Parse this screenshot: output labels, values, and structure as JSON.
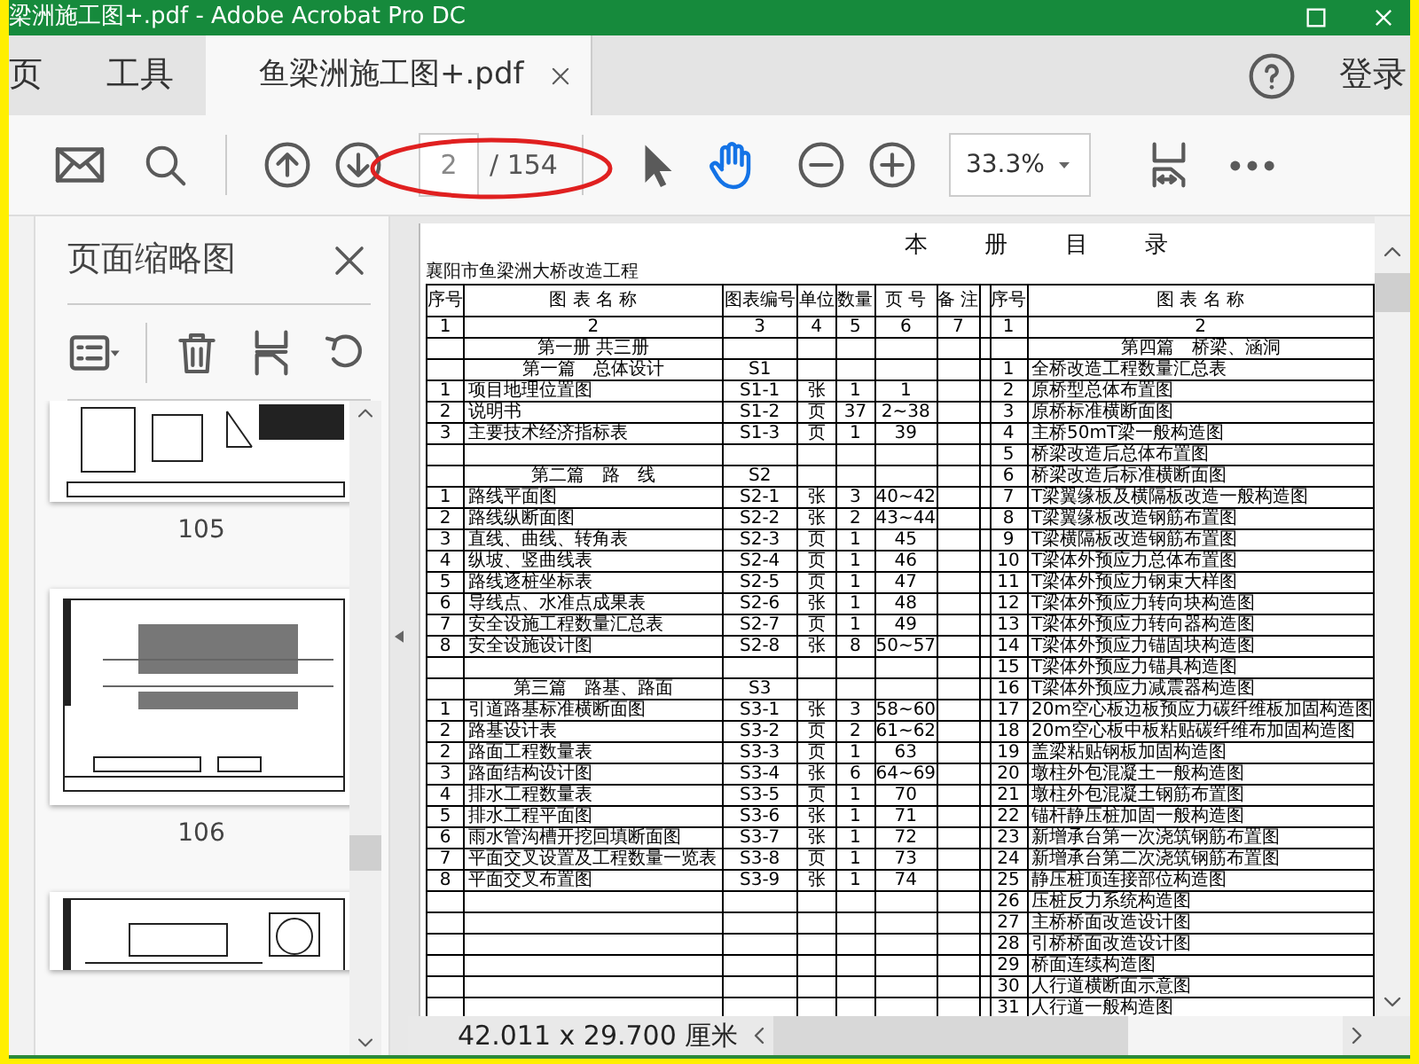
{
  "window": {
    "title": "梁洲施工图+.pdf - Adobe Acrobat Pro DC"
  },
  "tabs": [
    {
      "label": "页",
      "selected": false,
      "closable": false
    },
    {
      "label": "工具",
      "selected": false,
      "closable": false
    },
    {
      "label": "鱼梁洲施工图+.pdf",
      "selected": true,
      "closable": true
    }
  ],
  "account": {
    "sign_in": "登录"
  },
  "toolbar": {
    "page_number": "2",
    "page_count": "/ 154",
    "zoom": "33.3%",
    "tools": [
      {
        "kind": "select",
        "selected": false
      },
      {
        "kind": "hand",
        "selected": true
      }
    ]
  },
  "sidebar": {
    "title": "页面缩略图",
    "thumbnails": [
      {
        "kind": "detail",
        "label": "105"
      },
      {
        "kind": "section",
        "label": "106"
      },
      {
        "kind": "elevation"
      }
    ]
  },
  "document": {
    "title": "本 册 目 录",
    "project": "襄阳市鱼梁洲大桥改造工程",
    "left_table": {
      "columns": [
        "序号",
        "图 表 名 称",
        "图表编号",
        "单位",
        "数量",
        "页 号",
        "备 注"
      ],
      "rows": [
        {
          "kind": "index",
          "cells": [
            "1",
            "2",
            "3",
            "4",
            "5",
            "6",
            "7"
          ]
        },
        {
          "kind": "section",
          "title": "第一册 共三册"
        },
        {
          "kind": "section",
          "title": "第一篇　总体设计",
          "code": "S1"
        },
        {
          "kind": "item",
          "no": "1",
          "name": "项目地理位置图",
          "code": "S1-1",
          "unit": "张",
          "count": "1",
          "pages": "1"
        },
        {
          "kind": "item",
          "no": "2",
          "name": "说明书",
          "code": "S1-2",
          "unit": "页",
          "count": "37",
          "pages": "2~38"
        },
        {
          "kind": "item",
          "no": "3",
          "name": "主要技术经济指标表",
          "code": "S1-3",
          "unit": "页",
          "count": "1",
          "pages": "39"
        },
        {
          "kind": "blank"
        },
        {
          "kind": "section",
          "title": "第二篇　路　线",
          "code": "S2"
        },
        {
          "kind": "item",
          "no": "1",
          "name": "路线平面图",
          "code": "S2-1",
          "unit": "张",
          "count": "3",
          "pages": "40~42"
        },
        {
          "kind": "item",
          "no": "2",
          "name": "路线纵断面图",
          "code": "S2-2",
          "unit": "张",
          "count": "2",
          "pages": "43~44"
        },
        {
          "kind": "item",
          "no": "3",
          "name": "直线、曲线、转角表",
          "code": "S2-3",
          "unit": "页",
          "count": "1",
          "pages": "45"
        },
        {
          "kind": "item",
          "no": "4",
          "name": "纵坡、竖曲线表",
          "code": "S2-4",
          "unit": "页",
          "count": "1",
          "pages": "46"
        },
        {
          "kind": "item",
          "no": "5",
          "name": "路线逐桩坐标表",
          "code": "S2-5",
          "unit": "页",
          "count": "1",
          "pages": "47"
        },
        {
          "kind": "item",
          "no": "6",
          "name": "导线点、水准点成果表",
          "code": "S2-6",
          "unit": "张",
          "count": "1",
          "pages": "48"
        },
        {
          "kind": "item",
          "no": "7",
          "name": "安全设施工程数量汇总表",
          "code": "S2-7",
          "unit": "页",
          "count": "1",
          "pages": "49"
        },
        {
          "kind": "item",
          "no": "8",
          "name": "安全设施设计图",
          "code": "S2-8",
          "unit": "张",
          "count": "8",
          "pages": "50~57"
        },
        {
          "kind": "blank"
        },
        {
          "kind": "section",
          "title": "第三篇　路基、路面",
          "code": "S3"
        },
        {
          "kind": "item",
          "no": "1",
          "name": "引道路基标准横断面图",
          "code": "S3-1",
          "unit": "张",
          "count": "3",
          "pages": "58~60"
        },
        {
          "kind": "item",
          "no": "2",
          "name": "路基设计表",
          "code": "S3-2",
          "unit": "页",
          "count": "2",
          "pages": "61~62"
        },
        {
          "kind": "item",
          "no": "2",
          "name": "路面工程数量表",
          "code": "S3-3",
          "unit": "页",
          "count": "1",
          "pages": "63"
        },
        {
          "kind": "item",
          "no": "3",
          "name": "路面结构设计图",
          "code": "S3-4",
          "unit": "张",
          "count": "6",
          "pages": "64~69"
        },
        {
          "kind": "item",
          "no": "4",
          "name": "排水工程数量表",
          "code": "S3-5",
          "unit": "页",
          "count": "1",
          "pages": "70"
        },
        {
          "kind": "item",
          "no": "5",
          "name": "排水工程平面图",
          "code": "S3-6",
          "unit": "张",
          "count": "1",
          "pages": "71"
        },
        {
          "kind": "item",
          "no": "6",
          "name": "雨水管沟槽开挖回填断面图",
          "code": "S3-7",
          "unit": "张",
          "count": "1",
          "pages": "72"
        },
        {
          "kind": "item",
          "no": "7",
          "name": "平面交叉设置及工程数量一览表",
          "code": "S3-8",
          "unit": "页",
          "count": "1",
          "pages": "73"
        },
        {
          "kind": "item",
          "no": "8",
          "name": "平面交叉布置图",
          "code": "S3-9",
          "unit": "张",
          "count": "1",
          "pages": "74"
        },
        {
          "kind": "blank"
        },
        {
          "kind": "blank"
        },
        {
          "kind": "blank"
        },
        {
          "kind": "blank"
        },
        {
          "kind": "blank"
        },
        {
          "kind": "blank"
        }
      ]
    },
    "right_table": {
      "columns": [
        "序号",
        "图 表 名 称"
      ],
      "rows": [
        {
          "kind": "index",
          "cells": [
            "1",
            "2"
          ]
        },
        {
          "kind": "section",
          "title": "第四篇　桥梁、涵洞"
        },
        {
          "kind": "item",
          "no": "1",
          "name": "全桥改造工程数量汇总表"
        },
        {
          "kind": "item",
          "no": "2",
          "name": "原桥型总体布置图"
        },
        {
          "kind": "item",
          "no": "3",
          "name": "原桥标准横断面图"
        },
        {
          "kind": "item",
          "no": "4",
          "name": "主桥50mT梁一般构造图"
        },
        {
          "kind": "item",
          "no": "5",
          "name": "桥梁改造后总体布置图"
        },
        {
          "kind": "item",
          "no": "6",
          "name": "桥梁改造后标准横断面图"
        },
        {
          "kind": "item",
          "no": "7",
          "name": "T梁翼缘板及横隔板改造一般构造图"
        },
        {
          "kind": "item",
          "no": "8",
          "name": "T梁翼缘板改造钢筋布置图"
        },
        {
          "kind": "item",
          "no": "9",
          "name": "T梁横隔板改造钢筋布置图"
        },
        {
          "kind": "item",
          "no": "10",
          "name": "T梁体外预应力总体布置图"
        },
        {
          "kind": "item",
          "no": "11",
          "name": "T梁体外预应力钢束大样图"
        },
        {
          "kind": "item",
          "no": "12",
          "name": "T梁体外预应力转向块构造图"
        },
        {
          "kind": "item",
          "no": "13",
          "name": "T梁体外预应力转向器构造图"
        },
        {
          "kind": "item",
          "no": "14",
          "name": "T梁体外预应力锚固块构造图"
        },
        {
          "kind": "item",
          "no": "15",
          "name": "T梁体外预应力锚具构造图"
        },
        {
          "kind": "item",
          "no": "16",
          "name": "T梁体外预应力减震器构造图"
        },
        {
          "kind": "item",
          "no": "17",
          "name": "20m空心板边板预应力碳纤维板加固构造图"
        },
        {
          "kind": "item",
          "no": "18",
          "name": "20m空心板中板粘贴碳纤维布加固构造图"
        },
        {
          "kind": "item",
          "no": "19",
          "name": "盖梁粘贴钢板加固构造图"
        },
        {
          "kind": "item",
          "no": "20",
          "name": "墩柱外包混凝土一般构造图"
        },
        {
          "kind": "item",
          "no": "21",
          "name": "墩柱外包混凝土钢筋布置图"
        },
        {
          "kind": "item",
          "no": "22",
          "name": "锚杆静压桩加固一般构造图"
        },
        {
          "kind": "item",
          "no": "23",
          "name": "新增承台第一次浇筑钢筋布置图"
        },
        {
          "kind": "item",
          "no": "24",
          "name": "新增承台第二次浇筑钢筋布置图"
        },
        {
          "kind": "item",
          "no": "25",
          "name": "静压桩顶连接部位构造图"
        },
        {
          "kind": "item",
          "no": "26",
          "name": "压桩反力系统构造图"
        },
        {
          "kind": "item",
          "no": "27",
          "name": "主桥桥面改造设计图"
        },
        {
          "kind": "item",
          "no": "28",
          "name": "引桥桥面改造设计图"
        },
        {
          "kind": "item",
          "no": "29",
          "name": "桥面连续构造图"
        },
        {
          "kind": "item",
          "no": "30",
          "name": "人行道横断面示意图"
        },
        {
          "kind": "item",
          "no": "31",
          "name": "人行道一般构造图"
        }
      ]
    }
  },
  "status_bar": {
    "page_size": "42.011 x 29.700 厘米"
  }
}
